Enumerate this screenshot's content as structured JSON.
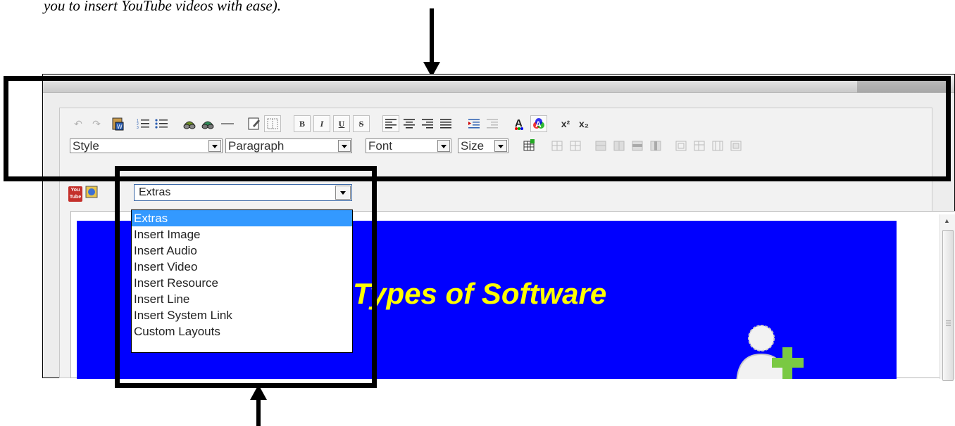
{
  "caption": {
    "text": "you to insert YouTube videos with ease)."
  },
  "toolbar": {
    "row1_buttons": [
      "undo-icon",
      "redo-icon",
      "paste-from-word-icon",
      "numbered-list-icon",
      "bulleted-list-icon",
      "link-icon",
      "unlink-icon",
      "horizontal-rule-icon",
      "edit-source-icon",
      "show-blocks-icon",
      "bold-icon",
      "italic-icon",
      "underline-icon",
      "strikethrough-icon",
      "align-left-icon",
      "align-center-icon",
      "align-right-icon",
      "justify-icon",
      "indent-icon",
      "outdent-icon",
      "text-color-icon",
      "background-color-icon",
      "superscript-icon",
      "subscript-icon"
    ],
    "style_combo": "Style",
    "paragraph_combo": "Paragraph",
    "font_combo": "Font",
    "size_combo": "Size",
    "bold_label": "B",
    "italic_label": "I",
    "underline_label": "U",
    "strike_label": "S",
    "superscript_label": "x²",
    "subscript_label": "x₂"
  },
  "extras": {
    "selected": "Extras",
    "options": [
      "Extras",
      "Insert Image",
      "Insert Audio",
      "Insert Video",
      "Insert Resource",
      "Insert Line",
      "Insert System Link",
      "Custom Layouts"
    ]
  },
  "youtube_icon": {
    "line1": "You",
    "line2": "Tube"
  },
  "slide": {
    "title": "Types of Software",
    "background": "#0000ff",
    "title_color": "#ffff00"
  },
  "colors": {
    "selection": "#3399ff"
  }
}
